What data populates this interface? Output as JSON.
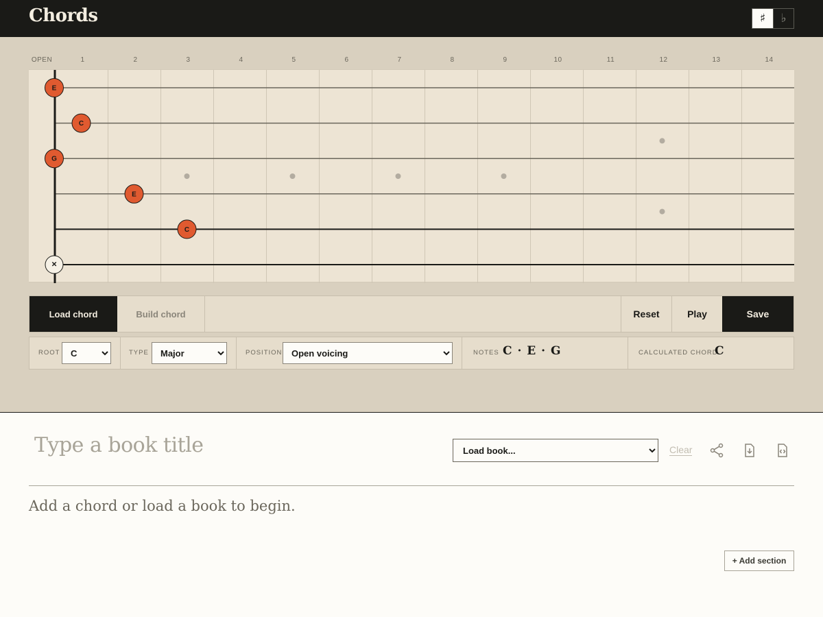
{
  "app": {
    "title": "Chords"
  },
  "accidentals": {
    "sharp": "♯",
    "flat": "♭",
    "selected": "sharp"
  },
  "fret_labels": [
    "OPEN",
    "1",
    "2",
    "3",
    "4",
    "5",
    "6",
    "7",
    "8",
    "9",
    "10",
    "11",
    "12",
    "13",
    "14"
  ],
  "fretboard": {
    "inlay_frets": [
      3,
      5,
      7,
      9
    ],
    "double_inlay_fret": 12,
    "markers": [
      {
        "string": 1,
        "fret": 0,
        "note": "E"
      },
      {
        "string": 2,
        "fret": 1,
        "note": "C"
      },
      {
        "string": 3,
        "fret": 0,
        "note": "G"
      },
      {
        "string": 4,
        "fret": 2,
        "note": "E"
      },
      {
        "string": 5,
        "fret": 3,
        "note": "C"
      },
      {
        "string": 6,
        "fret": 0,
        "note": "×",
        "muted": true
      }
    ],
    "colors": {
      "marker": "#e05a30",
      "string": "#5a5a52",
      "fret": "#cfc6b5",
      "nut": "#1a1a17",
      "inlay": "#b3aca0"
    }
  },
  "tabs": {
    "load": "Load chord",
    "build": "Build chord",
    "active": "load"
  },
  "actions": {
    "reset": "Reset",
    "play": "Play",
    "save": "Save"
  },
  "controls": {
    "root_label": "ROOT",
    "root_value": "C",
    "type_label": "TYPE",
    "type_value": "Major",
    "position_label": "POSITION",
    "position_value": "Open voicing",
    "notes_label": "NOTES",
    "notes_value": "C · E · G",
    "calc_label": "CALCULATED CHORD",
    "calc_value": "C"
  },
  "book": {
    "title_placeholder": "Type a book title",
    "load_select": "Load book...",
    "clear": "Clear",
    "empty_message": "Add a chord or load a book to begin.",
    "add_section": "+ Add section"
  }
}
